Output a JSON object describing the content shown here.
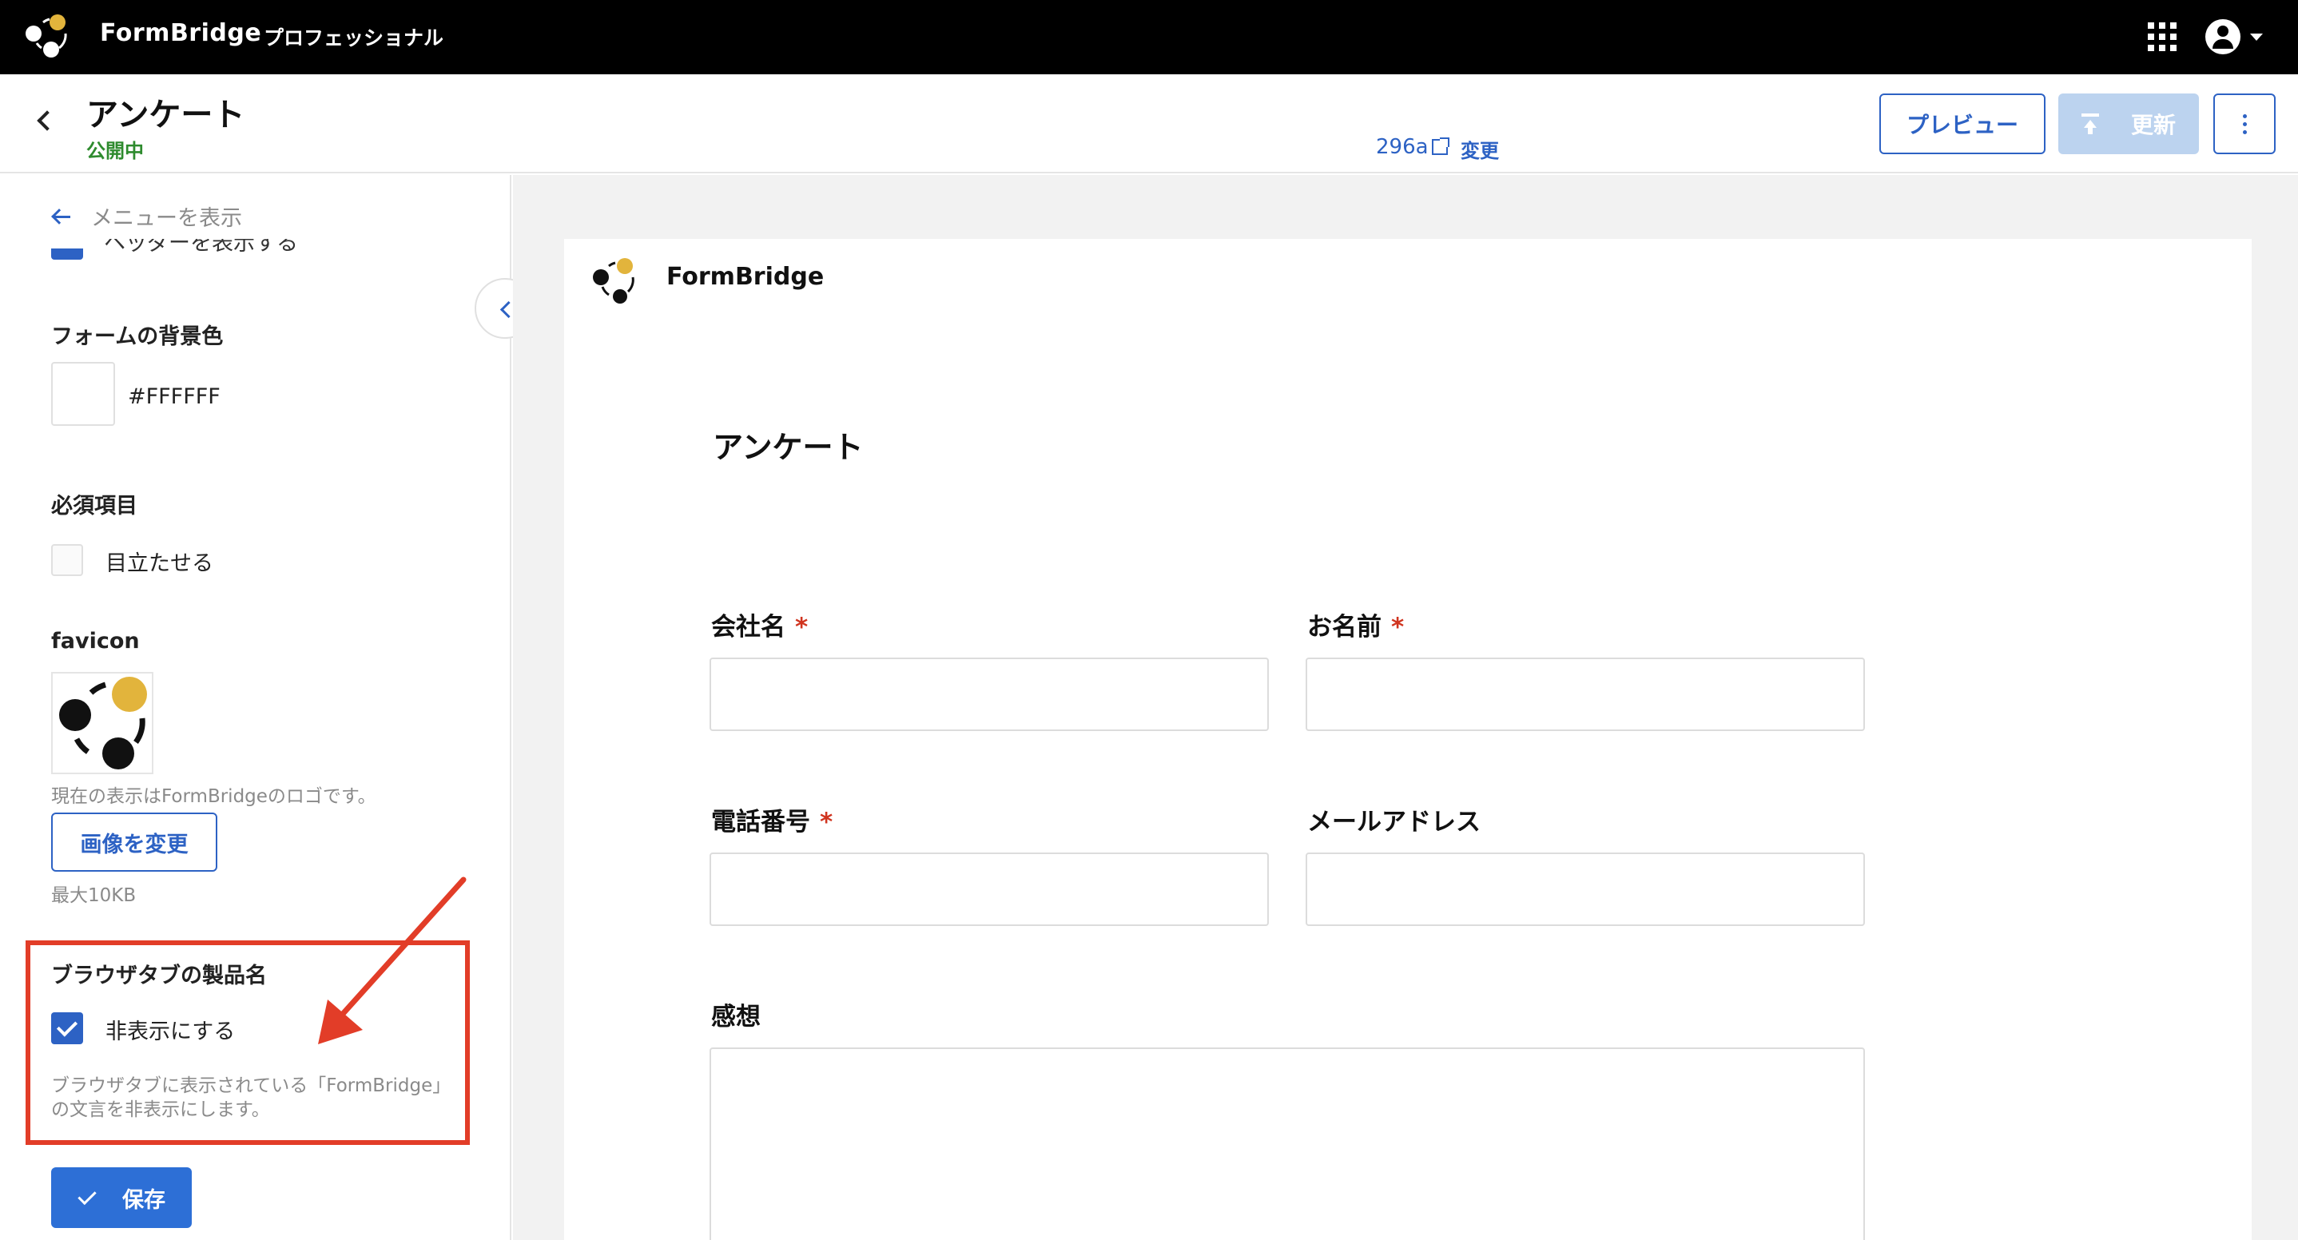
{
  "app": {
    "brand": "FormBridge",
    "plan": "プロフェッショナル"
  },
  "header": {
    "title": "アンケート",
    "status": "公開中",
    "link_text": "296a",
    "change_label": "変更",
    "preview_label": "プレビュー",
    "update_label": "更新"
  },
  "sidebar": {
    "menu_toggle_label": "メニューを表示",
    "cut_item_label": "ヘッダーを表示する",
    "bg_color": {
      "label": "フォームの背景色",
      "value": "#FFFFFF"
    },
    "required": {
      "label": "必須項目",
      "checkbox_label": "目立たせる",
      "checked": false
    },
    "favicon": {
      "label": "favicon",
      "hint": "現在の表示はFormBridgeのロゴです。",
      "change_button": "画像を変更",
      "max_size": "最大10KB"
    },
    "browser_tab": {
      "label": "ブラウザタブの製品名",
      "checkbox_label": "非表示にする",
      "checked": true,
      "hint_line1": "ブラウザタブに表示されている「FormBridge」",
      "hint_line2": "の文言を非表示にします。"
    },
    "save_label": "保存"
  },
  "preview": {
    "brand": "FormBridge",
    "form_title": "アンケート",
    "fields": [
      {
        "label": "会社名",
        "required": "*"
      },
      {
        "label": "お名前",
        "required": "*"
      },
      {
        "label": "電話番号",
        "required": "*"
      },
      {
        "label": "メールアドレス",
        "required": ""
      },
      {
        "label": "感想",
        "required": ""
      }
    ]
  },
  "colors": {
    "accent": "#2d62c4",
    "logo_gold": "#e2b43c",
    "status_green": "#2e8b2e",
    "highlight_red": "#e23d28",
    "required_red": "#d0341f"
  },
  "icons": {
    "top_right": [
      "apps-grid-icon",
      "account-icon",
      "caret-down-icon"
    ],
    "header": [
      "back-arrow-icon",
      "external-link-icon",
      "upload-icon",
      "more-vert-icon"
    ],
    "sidebar": [
      "arrow-left-icon",
      "checkmark-icon",
      "chevron-left-icon"
    ]
  }
}
